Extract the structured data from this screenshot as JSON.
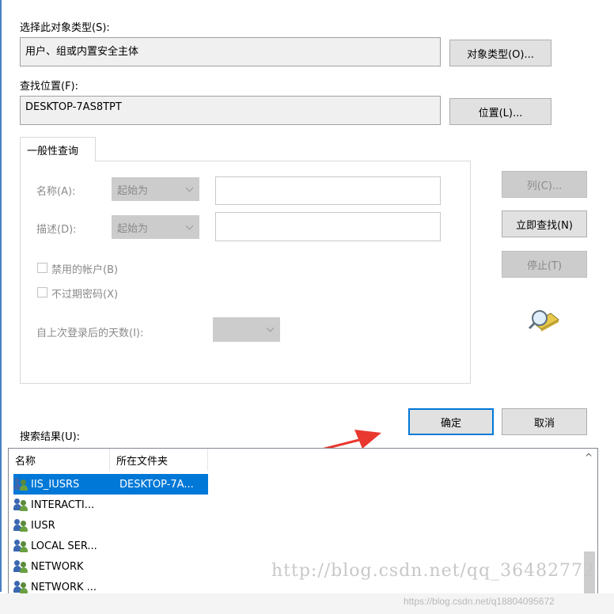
{
  "object_type": {
    "label": "选择此对象类型(S):",
    "value": "用户、组或内置安全主体",
    "button": "对象类型(O)..."
  },
  "location": {
    "label": "查找位置(F):",
    "value": "DESKTOP-7AS8TPT",
    "button": "位置(L)..."
  },
  "query": {
    "tab": "一般性查询",
    "name_label": "名称(A):",
    "name_mode": "起始为",
    "desc_label": "描述(D):",
    "desc_mode": "起始为",
    "disabled_accounts": "禁用的帐户(B)",
    "non_expiring_password": "不过期密码(X)",
    "days_since_logon": "自上次登录后的天数(I):"
  },
  "side_buttons": {
    "columns": "列(C)...",
    "find_now": "立即查找(N)",
    "stop": "停止(T)"
  },
  "dialog_buttons": {
    "ok": "确定",
    "cancel": "取消"
  },
  "results": {
    "label": "搜索结果(U):",
    "col_name": "名称",
    "col_folder": "所在文件夹",
    "rows": [
      {
        "name": "IIS_IUSRS",
        "folder": "DESKTOP-7A..."
      },
      {
        "name": "INTERACTI...",
        "folder": ""
      },
      {
        "name": "IUSR",
        "folder": ""
      },
      {
        "name": "LOCAL SER...",
        "folder": ""
      },
      {
        "name": "NETWORK",
        "folder": ""
      },
      {
        "name": "NETWORK ...",
        "folder": ""
      }
    ],
    "scroll_up": "^"
  },
  "watermarks": {
    "main": "http://blog.csdn.net/qq_36482772",
    "corner": "https://blog.csdn.net/q18804095672"
  },
  "colors": {
    "accent": "#0078d7",
    "arrow": "#e8382f"
  }
}
